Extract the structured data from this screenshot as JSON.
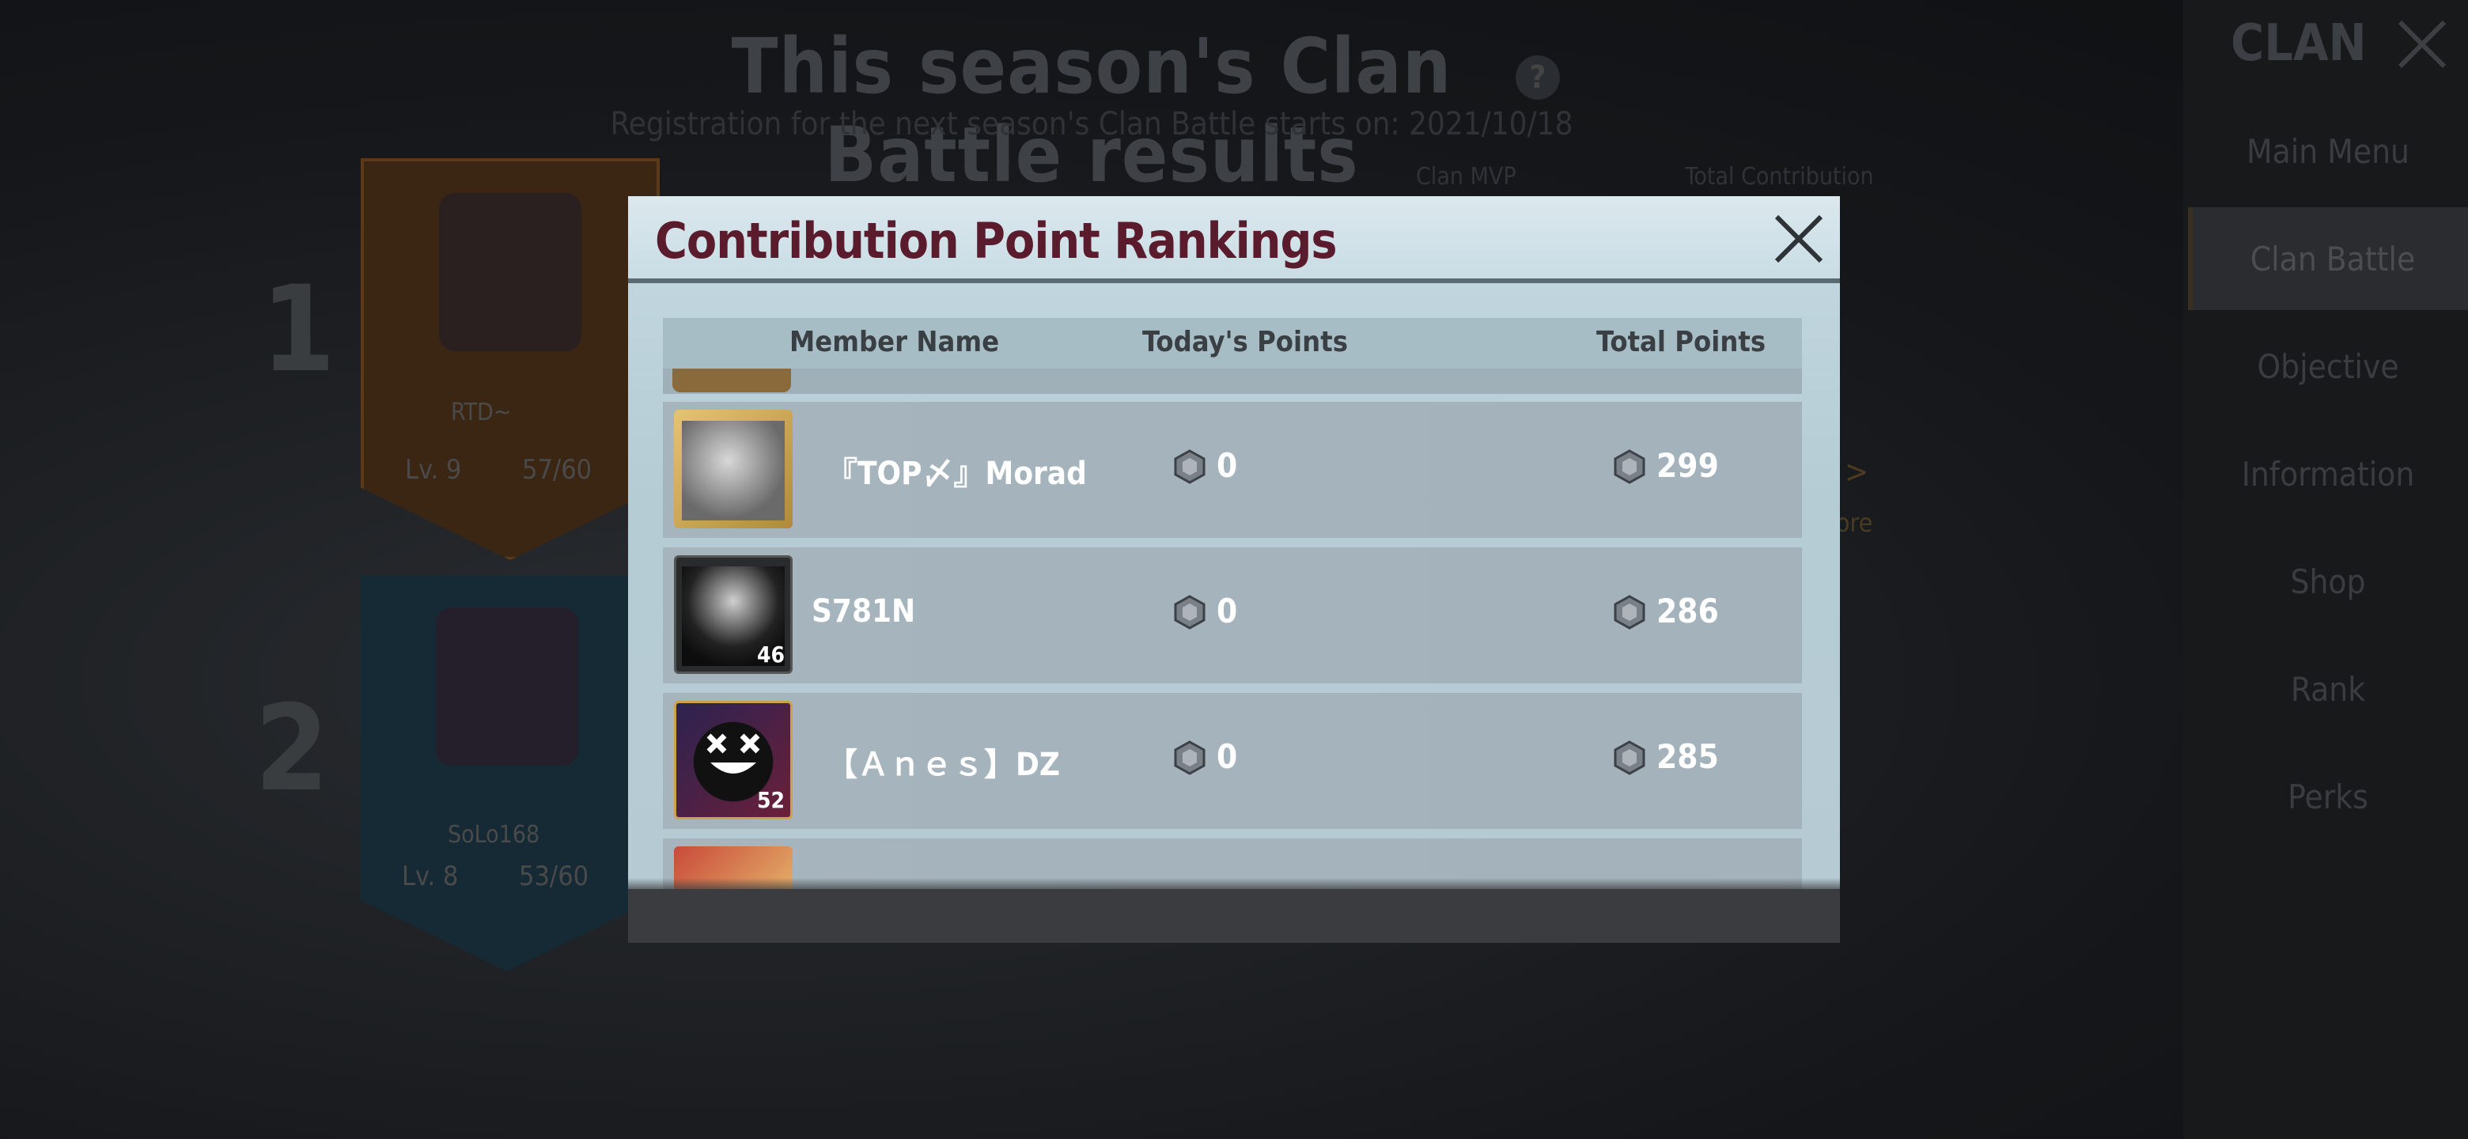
{
  "background": {
    "title": "This season's Clan Battle results",
    "help_icon": "?",
    "subtitle": "Registration for the next season's Clan Battle starts on: 2021/10/18",
    "col_mvp": "Clan MVP",
    "col_contribution": "Total Contribution",
    "teams": [
      {
        "rank": "1",
        "clan": "RTD~",
        "level": "Lv. 9",
        "members": "57/60"
      },
      {
        "rank": "2",
        "clan": "SoLo168",
        "level": "Lv. 8",
        "members": "53/60"
      }
    ],
    "more": "More"
  },
  "side_menu": {
    "title": "CLAN",
    "items": [
      "Main Menu",
      "Clan Battle",
      "Objective",
      "Information",
      "Shop",
      "Rank",
      "Perks"
    ],
    "active_index": 1
  },
  "modal": {
    "title": "Contribution Point Rankings",
    "columns": {
      "name": "Member Name",
      "today": "Today's Points",
      "total": "Total Points"
    },
    "rows": [
      {
        "name": "『TOP〆』Morad",
        "level": "",
        "today": "0",
        "total": "299"
      },
      {
        "name": "S781N",
        "level": "46",
        "today": "0",
        "total": "286"
      },
      {
        "name": "【Ａｎｅｓ】DZ",
        "level": "52",
        "today": "0",
        "total": "285"
      }
    ]
  },
  "colors": {
    "title": "#5a1b2c",
    "accent_gold": "#c9a24a"
  }
}
